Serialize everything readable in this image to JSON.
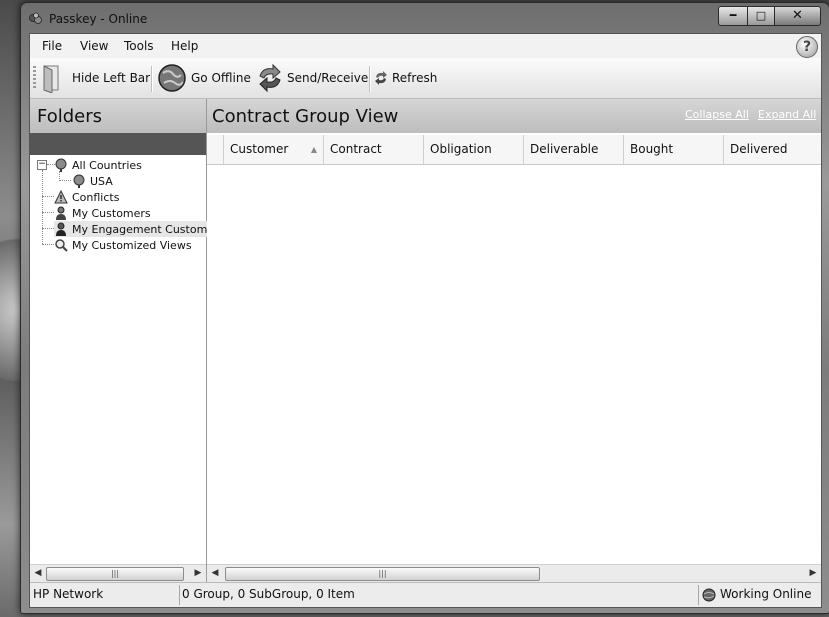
{
  "window": {
    "title": "Passkey - Online"
  },
  "menu": [
    "File",
    "View",
    "Tools",
    "Help"
  ],
  "toolbar": {
    "hide_left_bar": "Hide Left Bar",
    "go_offline": "Go Offline",
    "send_receive": "Send/Receive",
    "refresh": "Refresh"
  },
  "folders": {
    "title": "Folders",
    "items": [
      {
        "label": "All Countries",
        "icon": "globe-icon"
      },
      {
        "label": "USA",
        "icon": "globe-icon"
      },
      {
        "label": "Conflicts",
        "icon": "warning-icon"
      },
      {
        "label": "My Customers",
        "icon": "person-icon"
      },
      {
        "label": "My Engagement Customers",
        "icon": "person-icon"
      },
      {
        "label": "My Customized Views",
        "icon": "magnifier-icon"
      }
    ]
  },
  "view": {
    "title": "Contract Group View",
    "collapse_all": "Collapse All",
    "expand_all": "Expand All",
    "columns": [
      "Customer",
      "Contract",
      "Obligation",
      "Deliverable",
      "Bought",
      "Delivered"
    ]
  },
  "status": {
    "network": "HP Network",
    "summary": "0 Group, 0 SubGroup, 0 Item",
    "connection": "Working Online"
  }
}
